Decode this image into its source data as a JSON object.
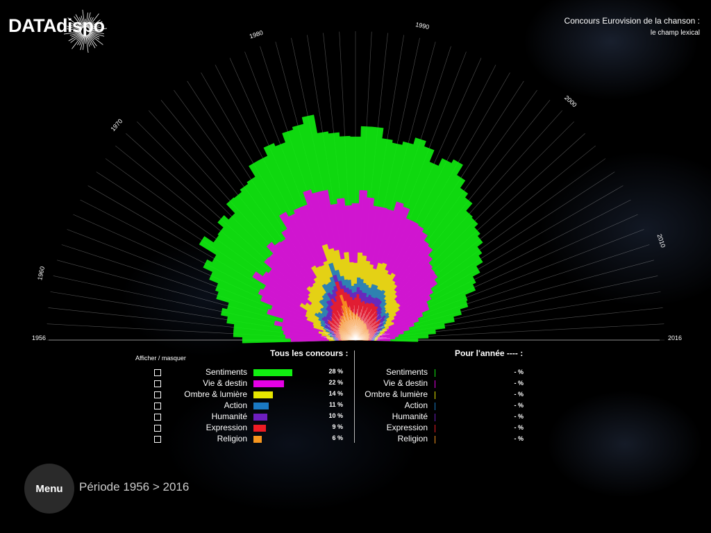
{
  "brand": {
    "logo_text": "DATAdispo"
  },
  "title": {
    "line1": "Concours Eurovision de la chanson :",
    "line2": "le champ lexical"
  },
  "chart_data": {
    "type": "area",
    "layout": "radial-stacked",
    "x_start": 1956,
    "x_end": 2016,
    "year_labels": [
      "1956",
      "1960",
      "1970",
      "1980",
      "1990",
      "2000",
      "2010",
      "2016"
    ],
    "series": [
      {
        "name": "Religion",
        "color": "#f7961e",
        "values": [
          12,
          13,
          12,
          14,
          13,
          15,
          14,
          16,
          18,
          17,
          20,
          19,
          22,
          20,
          24,
          22,
          26,
          25,
          30,
          27,
          32,
          30,
          35,
          45,
          60,
          50,
          40,
          35,
          32,
          30,
          28,
          30,
          26,
          25,
          24,
          22,
          20,
          22,
          20,
          18,
          20,
          19,
          18,
          17,
          16,
          15,
          14,
          16,
          15,
          14,
          13,
          12,
          14,
          13,
          12,
          11,
          12,
          11,
          10,
          11,
          10
        ]
      },
      {
        "name": "Expression",
        "color": "#ee1c24",
        "values": [
          4,
          4,
          5,
          6,
          8,
          6,
          10,
          9,
          12,
          15,
          14,
          20,
          18,
          16,
          14,
          18,
          16,
          20,
          22,
          25,
          28,
          24,
          26,
          22,
          20,
          18,
          22,
          24,
          22,
          20,
          25,
          28,
          26,
          22,
          25,
          24,
          28,
          26,
          30,
          32,
          28,
          30,
          26,
          24,
          22,
          20,
          18,
          22,
          20,
          18,
          16,
          14,
          12,
          10,
          8,
          8,
          6,
          5,
          5,
          4,
          4
        ]
      },
      {
        "name": "Humanité",
        "color": "#6e1fbf",
        "values": [
          4,
          5,
          4,
          5,
          6,
          5,
          7,
          8,
          10,
          8,
          9,
          10,
          8,
          10,
          9,
          8,
          12,
          10,
          9,
          8,
          10,
          12,
          10,
          8,
          10,
          12,
          10,
          9,
          11,
          10,
          8,
          10,
          12,
          14,
          12,
          10,
          12,
          10,
          8,
          10,
          12,
          10,
          8,
          10,
          9,
          8,
          10,
          9,
          8,
          7,
          8,
          6,
          7,
          6,
          5,
          5,
          4,
          4,
          3,
          3,
          3
        ]
      },
      {
        "name": "Action",
        "color": "#1a79c2",
        "values": [
          2,
          2,
          3,
          4,
          5,
          4,
          6,
          8,
          6,
          8,
          10,
          12,
          10,
          8,
          12,
          10,
          14,
          12,
          10,
          12,
          14,
          16,
          12,
          14,
          18,
          16,
          14,
          12,
          14,
          10,
          12,
          14,
          16,
          14,
          12,
          14,
          16,
          18,
          14,
          12,
          14,
          10,
          12,
          10,
          8,
          10,
          8,
          6,
          8,
          6,
          5,
          6,
          5,
          4,
          4,
          3,
          3,
          2,
          2,
          2,
          2
        ]
      },
      {
        "name": "Ombre & lumière",
        "color": "#e6e600",
        "values": [
          8,
          9,
          10,
          12,
          14,
          10,
          18,
          16,
          22,
          24,
          20,
          25,
          22,
          20,
          24,
          28,
          26,
          24,
          22,
          26,
          30,
          28,
          26,
          24,
          28,
          32,
          38,
          30,
          40,
          34,
          30,
          36,
          34,
          32,
          30,
          28,
          32,
          34,
          30,
          26,
          28,
          24,
          26,
          22,
          24,
          20,
          22,
          20,
          18,
          16,
          14,
          12,
          14,
          10,
          10,
          8,
          6,
          5,
          4,
          4,
          3
        ]
      },
      {
        "name": "Vie & destin",
        "color": "#e600e6",
        "values": [
          55,
          60,
          62,
          58,
          65,
          60,
          70,
          64,
          72,
          75,
          70,
          80,
          74,
          76,
          82,
          78,
          84,
          80,
          76,
          82,
          88,
          84,
          90,
          86,
          82,
          84,
          88,
          80,
          78,
          82,
          86,
          90,
          84,
          80,
          84,
          88,
          92,
          86,
          80,
          84,
          78,
          82,
          76,
          80,
          74,
          72,
          70,
          68,
          66,
          62,
          60,
          58,
          55,
          52,
          48,
          44,
          40,
          35,
          30,
          25,
          20
        ]
      },
      {
        "name": "Sentiments",
        "color": "#11f011",
        "values": [
          70,
          75,
          72,
          80,
          78,
          82,
          76,
          85,
          80,
          88,
          84,
          90,
          86,
          92,
          88,
          80,
          84,
          90,
          96,
          88,
          84,
          92,
          100,
          95,
          90,
          100,
          110,
          105,
          95,
          100,
          96,
          92,
          102,
          98,
          94,
          100,
          96,
          92,
          88,
          100,
          108,
          96,
          92,
          88,
          84,
          90,
          86,
          82,
          78,
          84,
          80,
          76,
          72,
          68,
          74,
          70,
          66,
          60,
          54,
          48,
          40
        ]
      }
    ]
  },
  "legend": {
    "toggle_header": "Afficher / masquer",
    "total_header": "Tous les concours :",
    "year_header": "Pour l'année ---- :",
    "items": [
      {
        "label": "Sentiments",
        "color": "#11f011",
        "total_pct": 28,
        "total_text": "28 %",
        "year_text": "- %"
      },
      {
        "label": "Vie & destin",
        "color": "#e600e6",
        "total_pct": 22,
        "total_text": "22 %",
        "year_text": "- %"
      },
      {
        "label": "Ombre & lumière",
        "color": "#e6e600",
        "total_pct": 14,
        "total_text": "14 %",
        "year_text": "- %"
      },
      {
        "label": "Action",
        "color": "#1a79c2",
        "total_pct": 11,
        "total_text": "11 %",
        "year_text": "- %"
      },
      {
        "label": "Humanité",
        "color": "#6e1fbf",
        "total_pct": 10,
        "total_text": "10 %",
        "year_text": "- %"
      },
      {
        "label": "Expression",
        "color": "#ee1c24",
        "total_pct": 9,
        "total_text": "9 %",
        "year_text": "- %"
      },
      {
        "label": "Religion",
        "color": "#f7961e",
        "total_pct": 6,
        "total_text": "6 %",
        "year_text": "- %"
      }
    ]
  },
  "footer": {
    "menu_label": "Menu",
    "period_text": "Période 1956 > 2016"
  }
}
